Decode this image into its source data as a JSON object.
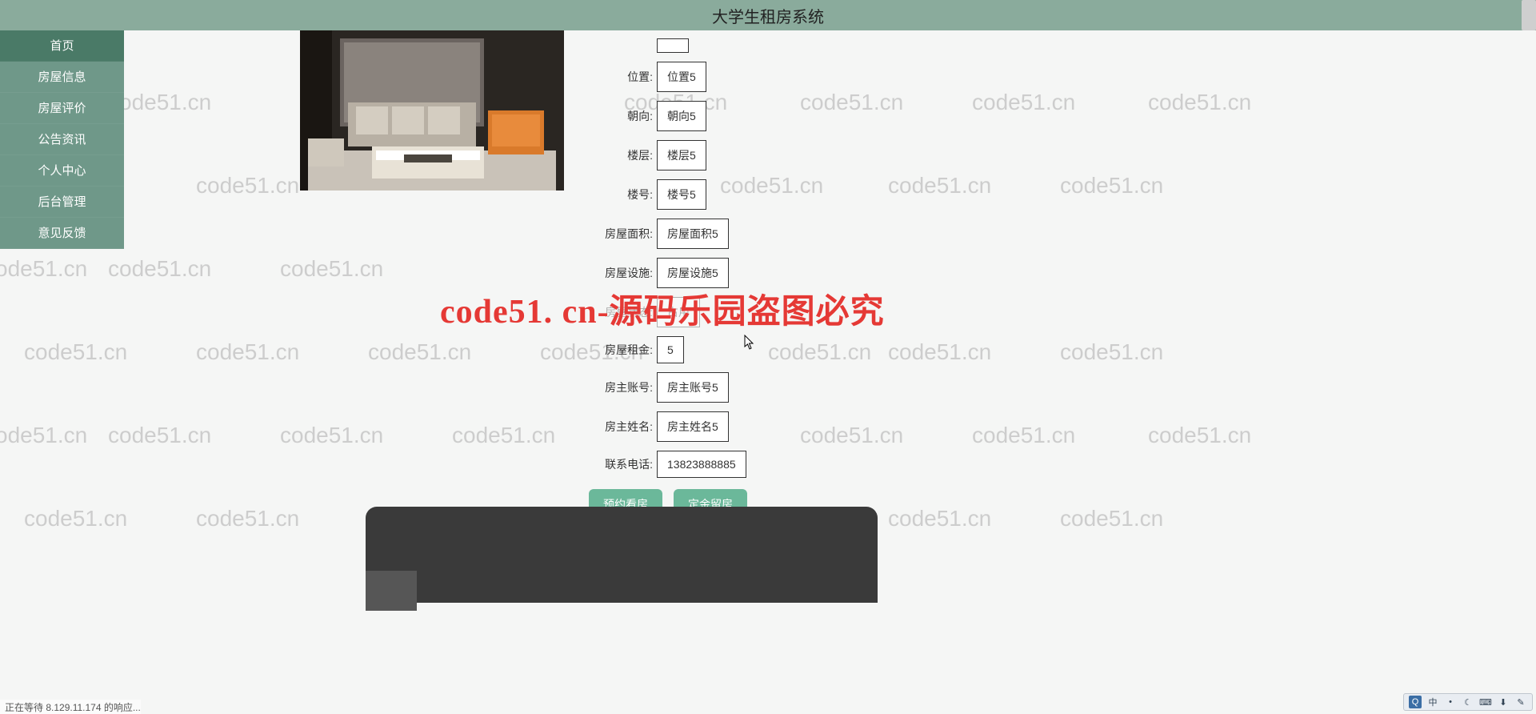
{
  "header": {
    "title": "大学生租房系统"
  },
  "sidebar": {
    "items": [
      {
        "label": "首页",
        "active": true
      },
      {
        "label": "房屋信息",
        "active": false
      },
      {
        "label": "房屋评价",
        "active": false
      },
      {
        "label": "公告资讯",
        "active": false
      },
      {
        "label": "个人中心",
        "active": false
      },
      {
        "label": "后台管理",
        "active": false
      },
      {
        "label": "意见反馈",
        "active": false
      }
    ]
  },
  "detail": {
    "fields": [
      {
        "label": "",
        "value": ""
      },
      {
        "label": "位置:",
        "value": "位置5"
      },
      {
        "label": "朝向:",
        "value": "朝向5"
      },
      {
        "label": "楼层:",
        "value": "楼层5"
      },
      {
        "label": "楼号:",
        "value": "楼号5"
      },
      {
        "label": "房屋面积:",
        "value": "房屋面积5"
      },
      {
        "label": "房屋设施:",
        "value": "房屋设施5"
      },
      {
        "label": "房屋状态:",
        "value": "占用"
      },
      {
        "label": "房屋租金:",
        "value": "5"
      },
      {
        "label": "房主账号:",
        "value": "房主账号5"
      },
      {
        "label": "房主姓名:",
        "value": "房主姓名5"
      },
      {
        "label": "联系电话:",
        "value": "13823888885"
      }
    ],
    "buttons": {
      "reserve": "预约看房",
      "deposit": "定金留房"
    }
  },
  "watermark": {
    "text": "code51.cn",
    "big": "code51. cn-源码乐园盗图必究"
  },
  "status": {
    "text": "正在等待 8.129.11.174 的响应..."
  },
  "ime": {
    "engine": "中",
    "dot1": "•",
    "moon": "☾",
    "kb": "⌨",
    "mic": "⬇",
    "gear": "✎"
  }
}
